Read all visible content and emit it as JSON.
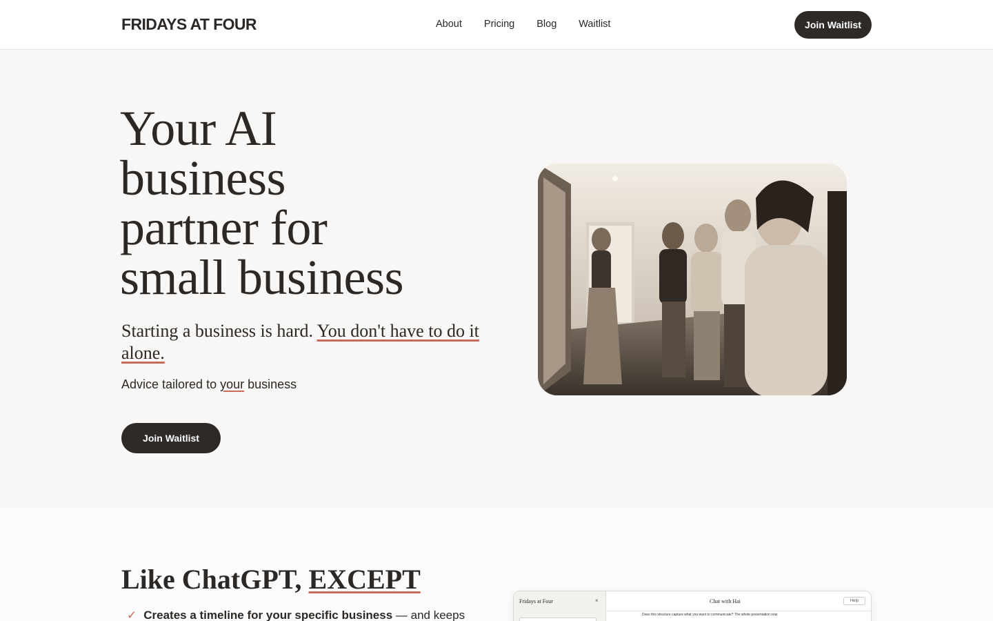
{
  "brand": "FRIDAYS AT FOUR",
  "nav": [
    "About",
    "Pricing",
    "Blog",
    "Waitlist"
  ],
  "header_cta": "Join Waitlist",
  "hero": {
    "title_lines": [
      "Your AI",
      "business",
      "partner for",
      "small business"
    ],
    "subtitle_plain": "Starting a business is hard. ",
    "subtitle_emph": "You don't have to do it alone.",
    "note_pre": "Advice tailored to ",
    "note_emph": "your",
    "note_post": " business",
    "cta": "Join Waitlist"
  },
  "section2": {
    "title_plain": "Like ChatGPT, ",
    "title_emph": "EXCEPT",
    "feature_bold": "Creates a timeline for your specific business",
    "feature_rest": " — and keeps"
  },
  "app_preview": {
    "brand": "Fridays at Four",
    "close": "×",
    "chat_title": "Chat with Hai",
    "help": "Help",
    "message": "Does this structure capture what you want to communicate? The whole presentation now"
  },
  "colors": {
    "accent_underline": "#c96a5b",
    "button_bg": "#2e2a27",
    "page_bg": "#f8f7f5"
  }
}
